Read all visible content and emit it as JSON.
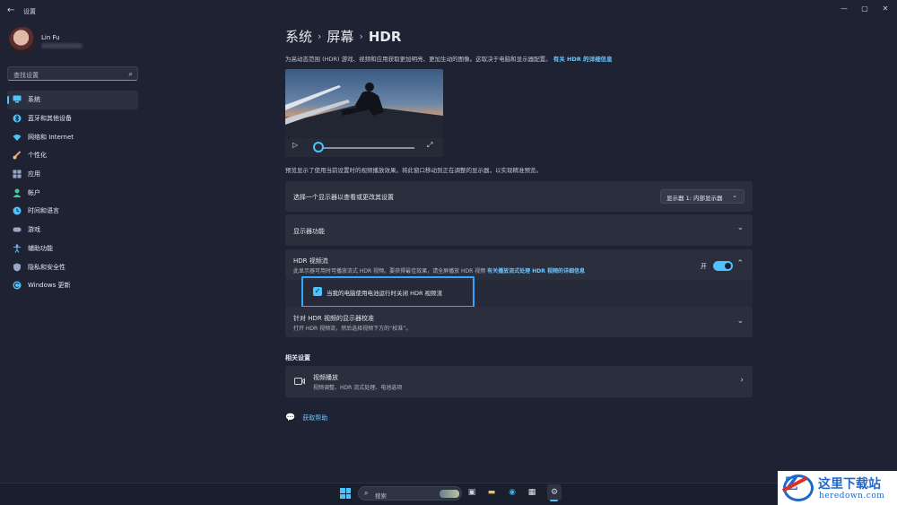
{
  "window": {
    "title": "设置",
    "controls": [
      "minimize-icon",
      "maximize-icon",
      "close-icon"
    ]
  },
  "profile": {
    "name": "Lin Fu"
  },
  "search": {
    "placeholder": "查找设置",
    "icon": "search-icon"
  },
  "sidebar": {
    "items": [
      {
        "label": "系统",
        "icon": "display-icon",
        "active": true,
        "color": "#4cc2ff"
      },
      {
        "label": "蓝牙和其他设备",
        "icon": "bluetooth-icon",
        "color": "#4cc2ff"
      },
      {
        "label": "网络和 Internet",
        "icon": "wifi-icon",
        "color": "#4cc2ff"
      },
      {
        "label": "个性化",
        "icon": "brush-icon",
        "color": "#f0a060"
      },
      {
        "label": "应用",
        "icon": "apps-icon",
        "color": "#9aa8c8"
      },
      {
        "label": "帐户",
        "icon": "person-icon",
        "color": "#3ccf9a"
      },
      {
        "label": "时间和语言",
        "icon": "globe-clock-icon",
        "color": "#4cc2ff"
      },
      {
        "label": "游戏",
        "icon": "gamepad-icon",
        "color": "#9aa8c8"
      },
      {
        "label": "辅助功能",
        "icon": "accessibility-icon",
        "color": "#4cc2ff"
      },
      {
        "label": "隐私和安全性",
        "icon": "shield-icon",
        "color": "#9aa8c8"
      },
      {
        "label": "Windows 更新",
        "icon": "update-icon",
        "color": "#4cc2ff"
      }
    ]
  },
  "breadcrumb": {
    "a": "系统",
    "b": "屏幕",
    "c": "HDR",
    "sep": "›"
  },
  "intro": {
    "text": "为高动态范围 (HDR) 游戏、视频和应用获取更加明亮、更加生动的图像。这取决于电脑和显示器配置。",
    "link": "有关 HDR 的详细信息"
  },
  "preview": {
    "play_icon": "play-icon",
    "expand_icon": "expand-icon",
    "progress": 0
  },
  "preview_caption": "预览显示了使用当前设置时的视频播放效果。将此窗口移动到正在调整的显示器，以实现精准预览。",
  "display_select": {
    "label": "选择一个显示器以查看或更改其设置",
    "value": "显示器 1: 内部显示器"
  },
  "display_capabilities": {
    "label": "显示器功能"
  },
  "hdr_stream": {
    "title": "HDR 视频流",
    "desc": "此显示器可用时可播放流式 HDR 视频。要获得最佳效果，请全屏播放 HDR 视频",
    "link": "有关播放流式处理 HDR 视频的详细信息",
    "toggle_label": "开",
    "toggle_on": true,
    "battery_option": {
      "label": "当我的电脑使用电池运行时关闭 HDR 视频流",
      "checked": true
    }
  },
  "calibration": {
    "title": "针对 HDR 视频的显示器校准",
    "desc": "打开 HDR 视频流，然后选择视频下方的“校准”。"
  },
  "related": {
    "title": "相关设置",
    "items": [
      {
        "title": "视频播放",
        "desc": "视频调整、HDR 流式处理、电池选项",
        "icon": "video-icon"
      }
    ]
  },
  "help": {
    "label": "获取帮助",
    "icon": "help-icon"
  },
  "taskbar": {
    "search_label": "搜索",
    "icons": [
      "start-icon",
      "search-icon",
      "task-view-icon",
      "file-explorer-icon",
      "edge-icon",
      "store-icon",
      "settings-icon"
    ]
  },
  "watermark": {
    "cn": "这里下载站",
    "en": "heredown.com"
  }
}
